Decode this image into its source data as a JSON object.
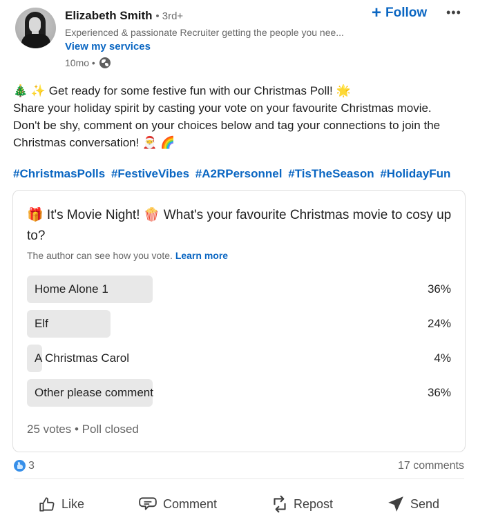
{
  "author": {
    "name": "Elizabeth Smith",
    "degree": "• 3rd+",
    "headline": "Experienced & passionate Recruiter getting the people you nee...",
    "services_link": "View my services",
    "time": "10mo •",
    "visibility_icon": "globe-icon"
  },
  "header_actions": {
    "follow_icon": "+",
    "follow_label": "Follow",
    "more_label": "•••"
  },
  "post": {
    "lines": [
      "🎄 ✨ Get ready for some festive fun with our Christmas Poll! 🌟",
      "Share your holiday spirit by casting your vote on your favourite Christmas movie.",
      "Don't be shy, comment on your choices below and tag your connections to join the",
      "Christmas conversation! 🎅 🌈"
    ],
    "hashtags": [
      "#ChristmasPolls",
      "#FestiveVibes",
      "#A2RPersonnel",
      "#TisTheSeason",
      "#HolidayFun"
    ]
  },
  "poll": {
    "question": "🎁 It's Movie Night! 🍿 What's your favourite Christmas movie to cosy up to?",
    "note": "The author can see how you vote.",
    "learn_more": "Learn more",
    "options": [
      {
        "label": "Home Alone 1",
        "percent_text": "36%",
        "percent": 36
      },
      {
        "label": "Elf",
        "percent_text": "24%",
        "percent": 24
      },
      {
        "label": "A Christmas Carol",
        "percent_text": "4%",
        "percent": 4
      },
      {
        "label": "Other please comment",
        "percent_text": "36%",
        "percent": 36
      }
    ],
    "footer": "25 votes • Poll closed"
  },
  "social": {
    "reaction_icon": "like-reaction-icon",
    "reactions_count": "3",
    "comments_count": "17 comments"
  },
  "actions": {
    "like": "Like",
    "comment": "Comment",
    "repost": "Repost",
    "send": "Send"
  },
  "colors": {
    "accent": "#0a66c2",
    "bar": "#e8e8e8",
    "muted": "#666666"
  }
}
